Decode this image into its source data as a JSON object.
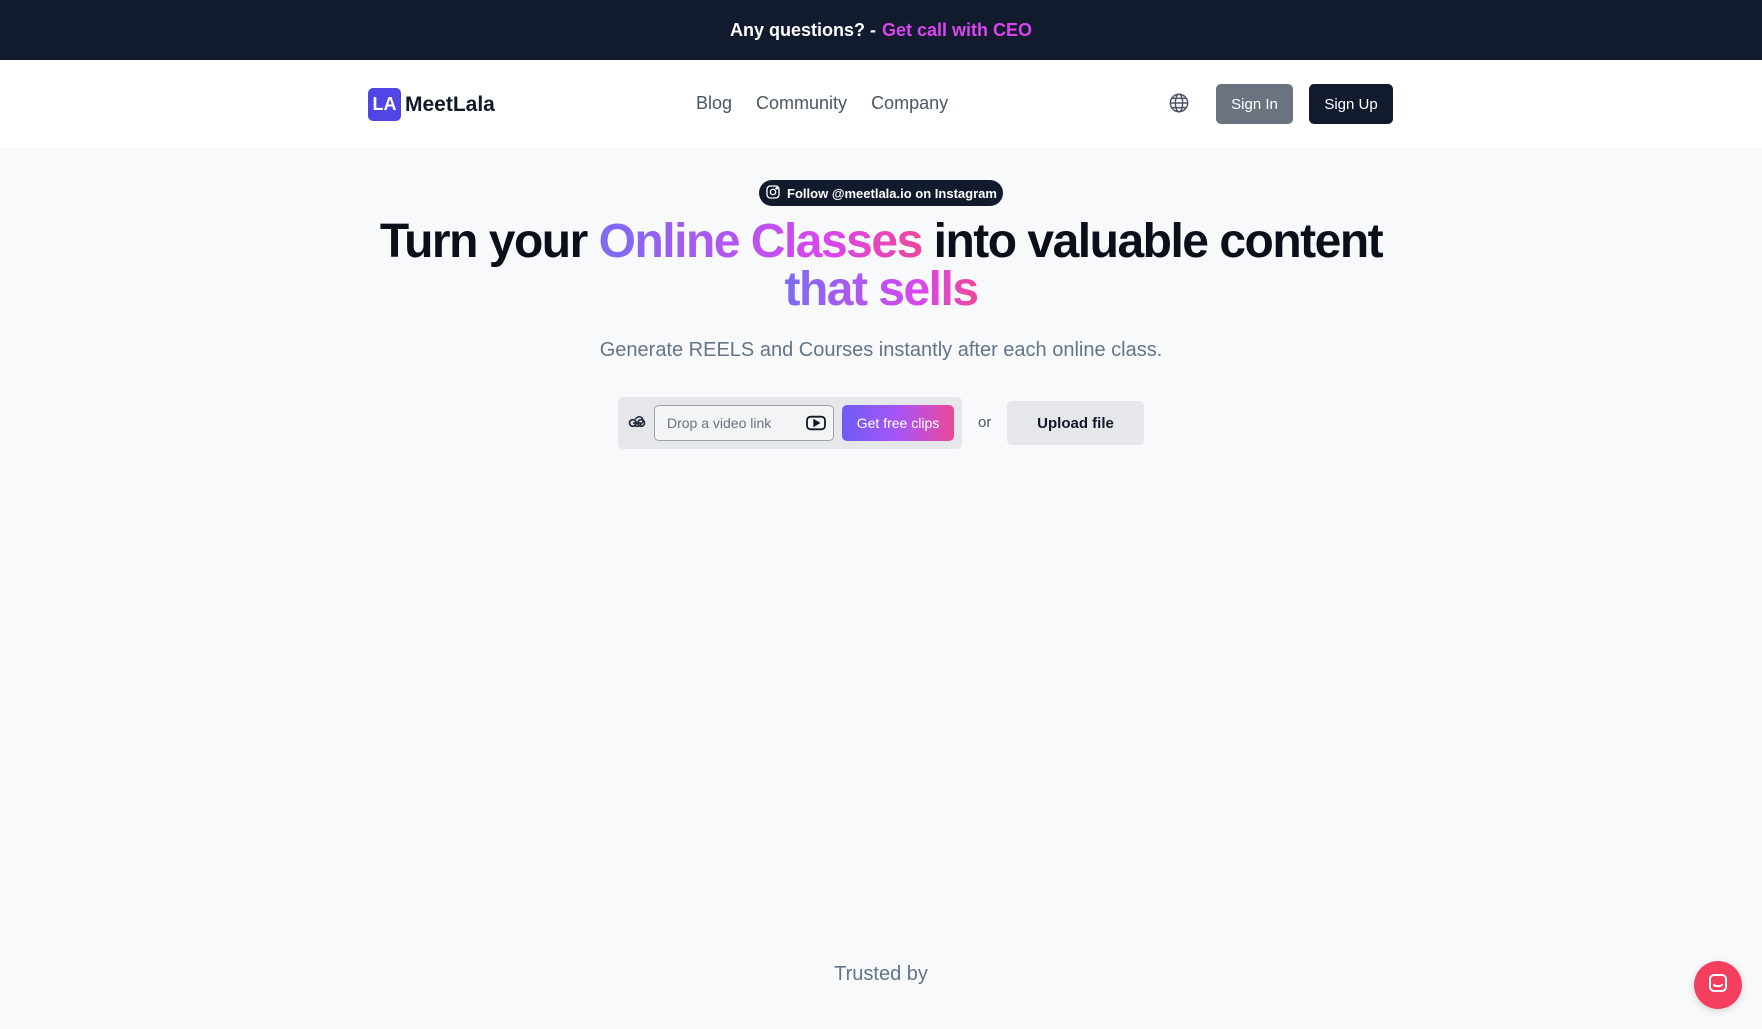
{
  "banner": {
    "question": "Any questions? -",
    "cta": "Get call with CEO"
  },
  "header": {
    "logo_mark": "LA",
    "logo_text": "MeetLala",
    "nav": [
      "Blog",
      "Community",
      "Company"
    ],
    "language_icon": "globe-icon",
    "sign_in": "Sign In",
    "sign_up": "Sign Up"
  },
  "hero": {
    "instagram_pill": "Follow @meetlala.io on Instagram",
    "headline_part1": "Turn your ",
    "headline_highlight1": "Online Classes",
    "headline_part2": " into valuable content",
    "headline_highlight2": "that sells",
    "subtitle": "Generate REELS and Courses instantly after each online class."
  },
  "form": {
    "link_icon": "link-icon",
    "video_placeholder": "Drop a video link",
    "video_value": "",
    "play_icon": "youtube-icon",
    "get_clips": "Get free clips",
    "or": "or",
    "upload": "Upload file"
  },
  "trusted_by": "Trusted by",
  "chat_icon": "chat-icon",
  "colors": {
    "banner_bg": "#121a2e",
    "cta": "#d946ef",
    "brand": "#4f46e5",
    "gradient_start": "#7c6cf2",
    "gradient_end": "#ec4899",
    "chat_bg": "#f43f5e"
  }
}
